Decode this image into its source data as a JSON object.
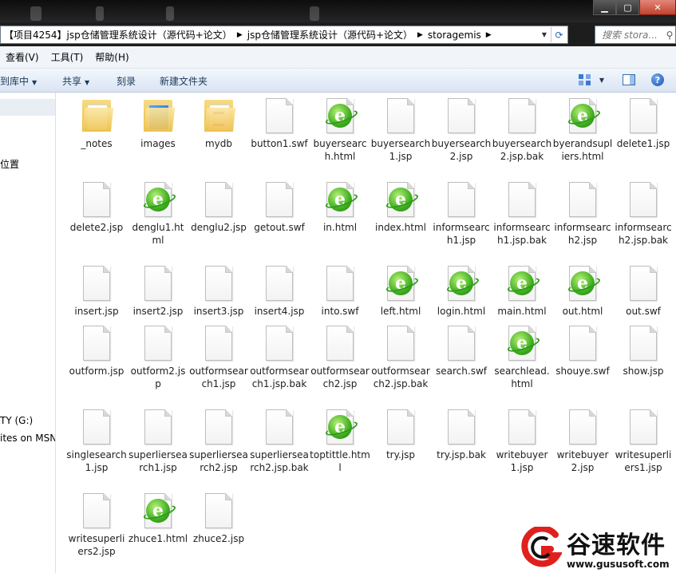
{
  "address": {
    "crumbs": [
      "【项目4254】jsp仓储管理系统设计（源代码+论文）",
      "jsp仓储管理系统设计（源代码+论文）",
      "storagemis"
    ],
    "search_placeholder": "搜索 stora..."
  },
  "menu": [
    "查看(V)",
    "工具(T)",
    "帮助(H)"
  ],
  "commands": {
    "include_library": "到库中",
    "share": "共享",
    "burn": "刻录",
    "new_folder": "新建文件夹"
  },
  "nav": {
    "items": [
      "位置",
      "TY (G:)",
      "ites on MSN"
    ]
  },
  "files": [
    {
      "name": "_notes",
      "type": "folder-notes"
    },
    {
      "name": "images",
      "type": "folder-images"
    },
    {
      "name": "mydb",
      "type": "folder-db"
    },
    {
      "name": "button1.swf",
      "type": "doc"
    },
    {
      "name": "buyersearch.html",
      "type": "html"
    },
    {
      "name": "buyersearch1.jsp",
      "type": "doc"
    },
    {
      "name": "buyersearch2.jsp",
      "type": "doc"
    },
    {
      "name": "buyersearch2.jsp.bak",
      "type": "doc"
    },
    {
      "name": "byerandsupliers.html",
      "type": "html"
    },
    {
      "name": "delete1.jsp",
      "type": "doc"
    },
    {
      "name": "delete2.jsp",
      "type": "doc"
    },
    {
      "name": "denglu1.html",
      "type": "html"
    },
    {
      "name": "denglu2.jsp",
      "type": "doc"
    },
    {
      "name": "getout.swf",
      "type": "doc"
    },
    {
      "name": "in.html",
      "type": "html"
    },
    {
      "name": "index.html",
      "type": "html"
    },
    {
      "name": "informsearch1.jsp",
      "type": "doc"
    },
    {
      "name": "informsearch1.jsp.bak",
      "type": "doc"
    },
    {
      "name": "informsearch2.jsp",
      "type": "doc"
    },
    {
      "name": "informsearch2.jsp.bak",
      "type": "doc"
    },
    {
      "name": "insert.jsp",
      "type": "doc"
    },
    {
      "name": "insert2.jsp",
      "type": "doc"
    },
    {
      "name": "insert3.jsp",
      "type": "doc"
    },
    {
      "name": "insert4.jsp",
      "type": "doc"
    },
    {
      "name": "into.swf",
      "type": "doc"
    },
    {
      "name": "left.html",
      "type": "html"
    },
    {
      "name": "login.html",
      "type": "html"
    },
    {
      "name": "main.html",
      "type": "html"
    },
    {
      "name": "out.html",
      "type": "html"
    },
    {
      "name": "out.swf",
      "type": "doc"
    },
    {
      "name": "outform.jsp",
      "type": "doc"
    },
    {
      "name": "outform2.jsp",
      "type": "doc"
    },
    {
      "name": "outformsearch1.jsp",
      "type": "doc"
    },
    {
      "name": "outformsearch1.jsp.bak",
      "type": "doc"
    },
    {
      "name": "outformsearch2.jsp",
      "type": "doc"
    },
    {
      "name": "outformsearch2.jsp.bak",
      "type": "doc"
    },
    {
      "name": "search.swf",
      "type": "doc"
    },
    {
      "name": "searchlead.html",
      "type": "html"
    },
    {
      "name": "shouye.swf",
      "type": "doc"
    },
    {
      "name": "show.jsp",
      "type": "doc"
    },
    {
      "name": "singlesearch1.jsp",
      "type": "doc"
    },
    {
      "name": "superliersearch1.jsp",
      "type": "doc"
    },
    {
      "name": "superliersearch2.jsp",
      "type": "doc"
    },
    {
      "name": "superliersearch2.jsp.bak",
      "type": "doc"
    },
    {
      "name": "toptittle.html",
      "type": "html"
    },
    {
      "name": "try.jsp",
      "type": "doc"
    },
    {
      "name": "try.jsp.bak",
      "type": "doc"
    },
    {
      "name": "writebuyer1.jsp",
      "type": "doc"
    },
    {
      "name": "writebuyer2.jsp",
      "type": "doc"
    },
    {
      "name": "writesuperliers1.jsp",
      "type": "doc"
    },
    {
      "name": "writesuperliers2.jsp",
      "type": "doc"
    },
    {
      "name": "zhuce1.html",
      "type": "html"
    },
    {
      "name": "zhuce2.jsp",
      "type": "doc"
    }
  ],
  "watermark": {
    "title": "谷速软件",
    "url": "www.gususoft.com"
  }
}
